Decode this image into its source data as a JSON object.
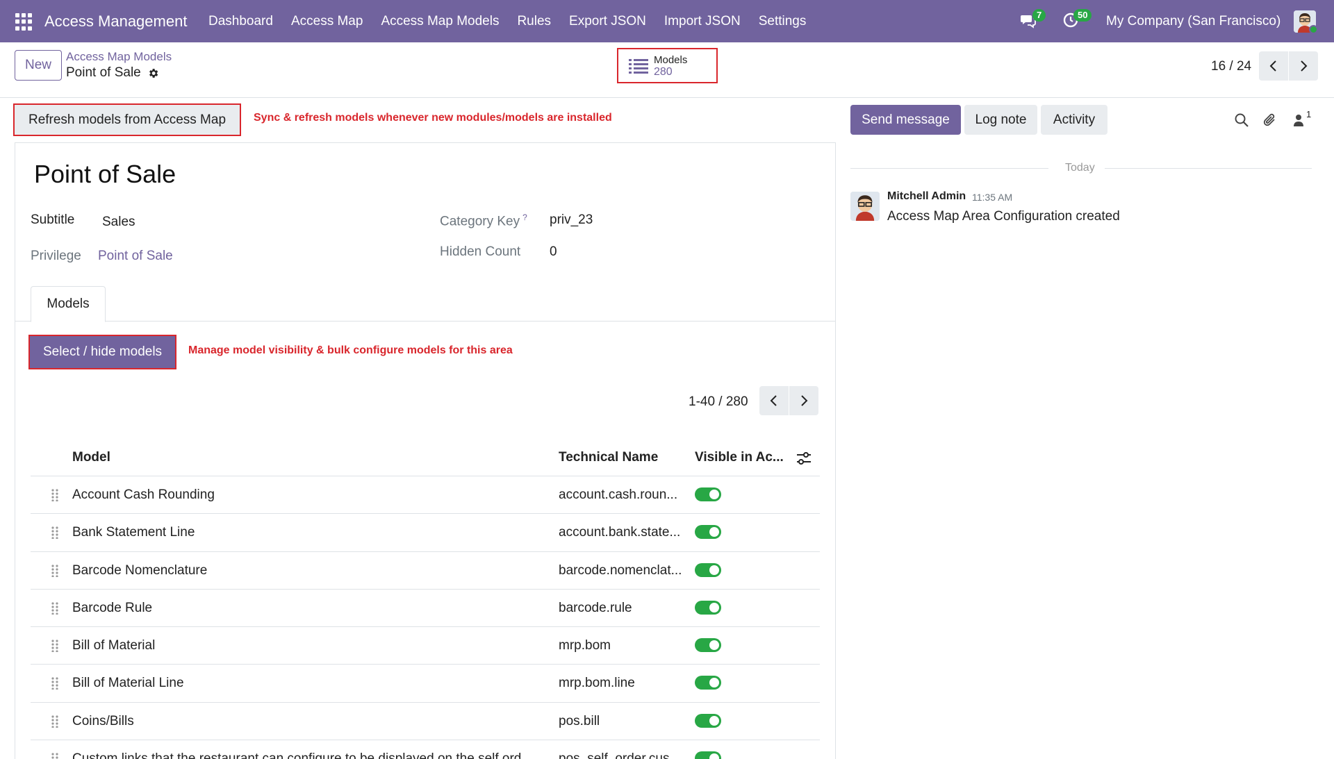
{
  "navbar": {
    "app_title": "Access Management",
    "menu": [
      "Dashboard",
      "Access Map",
      "Access Map Models",
      "Rules",
      "Export JSON",
      "Import JSON",
      "Settings"
    ],
    "messages_badge": "7",
    "activities_badge": "50",
    "company": "My Company (San Francisco)",
    "accent_color": "#71639e"
  },
  "control_panel": {
    "new_label": "New",
    "breadcrumb_parent": "Access Map Models",
    "breadcrumb_current": "Point of Sale",
    "smart_button": {
      "label": "Models",
      "value": "280",
      "icon": "list-icon"
    },
    "pager": "16 / 24"
  },
  "form": {
    "refresh_label": "Refresh models from Access Map",
    "refresh_help": "Sync & refresh models whenever new modules/models are installed",
    "title": "Point of Sale",
    "fields": {
      "subtitle_label": "Subtitle",
      "subtitle_value": "Sales",
      "privilege_label": "Privilege",
      "privilege_value": "Point of Sale",
      "category_key_label": "Category Key",
      "category_key_help": "?",
      "category_key_value": "priv_23",
      "hidden_count_label": "Hidden Count",
      "hidden_count_value": "0"
    },
    "tab_label": "Models",
    "select_hide_label": "Select / hide models",
    "select_hide_help": "Manage model visibility & bulk configure models for this area",
    "list_pager": "1-40 / 280",
    "table": {
      "headers": [
        "Model",
        "Technical Name",
        "Visible in Ac..."
      ],
      "rows": [
        {
          "model": "Account Cash Rounding",
          "technical": "account.cash.roun...",
          "visible": true
        },
        {
          "model": "Bank Statement Line",
          "technical": "account.bank.state...",
          "visible": true
        },
        {
          "model": "Barcode Nomenclature",
          "technical": "barcode.nomenclat...",
          "visible": true
        },
        {
          "model": "Barcode Rule",
          "technical": "barcode.rule",
          "visible": true
        },
        {
          "model": "Bill of Material",
          "technical": "mrp.bom",
          "visible": true
        },
        {
          "model": "Bill of Material Line",
          "technical": "mrp.bom.line",
          "visible": true
        },
        {
          "model": "Coins/Bills",
          "technical": "pos.bill",
          "visible": true
        },
        {
          "model": "Custom links that the restaurant can configure to be displayed on the self ord...",
          "technical": "pos_self_order.cus...",
          "visible": true
        }
      ]
    }
  },
  "chatter": {
    "send_message": "Send message",
    "log_note": "Log note",
    "activity": "Activity",
    "followers_count": "1",
    "today": "Today",
    "message": {
      "author": "Mitchell Admin",
      "time": "11:35 AM",
      "body": "Access Map Area Configuration created"
    }
  }
}
